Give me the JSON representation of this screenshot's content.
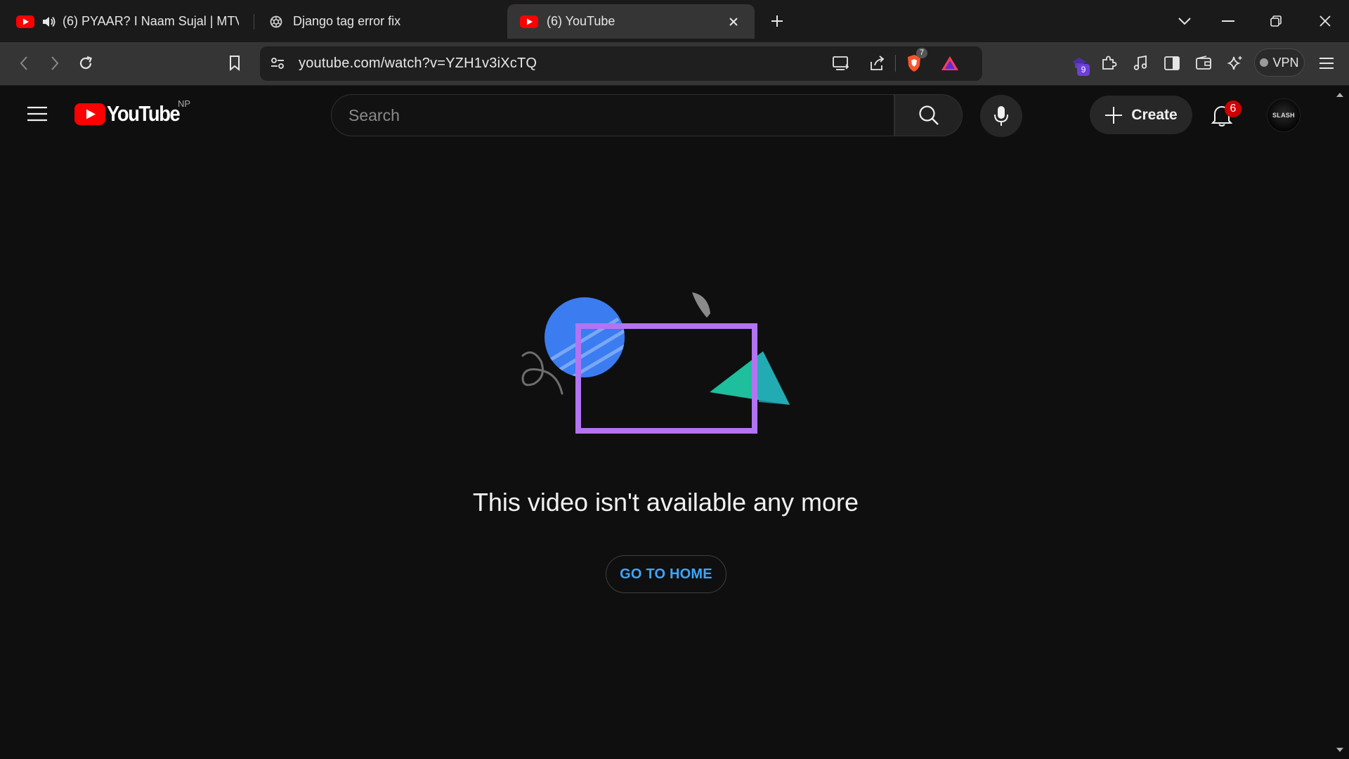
{
  "browser": {
    "tabs": [
      {
        "title": "(6) PYAAR? I Naam Sujal | MTV I",
        "icon": "youtube-favicon",
        "playing_audio": true
      },
      {
        "title": "Django tag error fix",
        "icon": "openai-favicon"
      },
      {
        "title": "(6) YouTube",
        "icon": "youtube-favicon",
        "active": true
      }
    ],
    "url": "youtube.com/watch?v=YZH1v3iXcTQ",
    "brave_shield_count": "7",
    "extensions_badge": "9",
    "vpn_label": "VPN"
  },
  "youtube": {
    "country_code": "NP",
    "logo_text": "YouTube",
    "search_placeholder": "Search",
    "create_label": "Create",
    "notification_count": "6",
    "avatar_text": "SLASH"
  },
  "error_page": {
    "message": "This video isn't available any more",
    "home_button": "GO TO HOME"
  },
  "colors": {
    "page_bg": "#0f0f0f",
    "link_blue": "#3ea6ff",
    "yt_red": "#ff0000",
    "badge_red": "#cc0000"
  }
}
